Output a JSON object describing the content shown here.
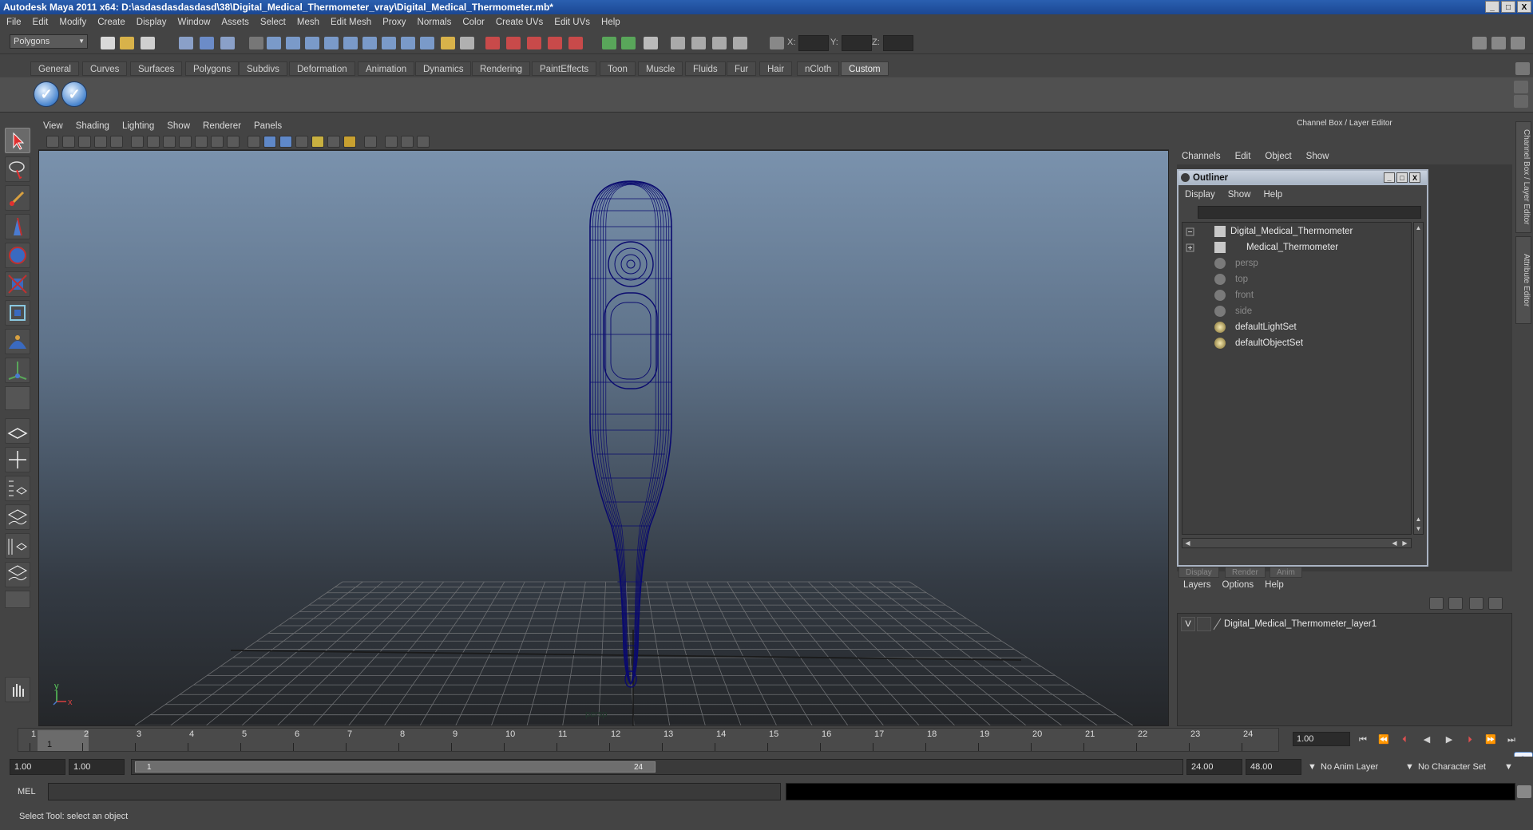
{
  "window": {
    "title": "Autodesk Maya 2011 x64: D:\\asdasdasdasdasd\\38\\Digital_Medical_Thermometer_vray\\Digital_Medical_Thermometer.mb*",
    "buttons": [
      "_",
      "□",
      "X"
    ]
  },
  "menubar": [
    "File",
    "Edit",
    "Modify",
    "Create",
    "Display",
    "Window",
    "Assets",
    "Select",
    "Mesh",
    "Edit Mesh",
    "Proxy",
    "Normals",
    "Color",
    "Create UVs",
    "Edit UVs",
    "Help"
  ],
  "statusline": {
    "mode": "Polygons",
    "coord_labels": [
      "X:",
      "Y:",
      "Z:"
    ]
  },
  "shelf": {
    "tabs": [
      "General",
      "Curves",
      "Surfaces",
      "Polygons",
      "Subdivs",
      "Deformation",
      "Animation",
      "Dynamics",
      "Rendering",
      "PaintEffects",
      "Toon",
      "Muscle",
      "Fluids",
      "Fur",
      "Hair",
      "nCloth",
      "Custom"
    ],
    "active_tab": "Custom",
    "buttons": [
      "check-icon",
      "check-icon"
    ]
  },
  "viewport": {
    "menu": [
      "View",
      "Shading",
      "Lighting",
      "Show",
      "Renderer",
      "Panels"
    ],
    "camera": "persp",
    "axis_y": "y",
    "axis_x": "x"
  },
  "channel_box": {
    "title": "Channel Box / Layer Editor",
    "menu": [
      "Channels",
      "Edit",
      "Object",
      "Show"
    ]
  },
  "side_tabs": [
    "Channel Box / Layer Editor",
    "Attribute Editor"
  ],
  "outliner": {
    "title": "Outliner",
    "menu": [
      "Display",
      "Show",
      "Help"
    ],
    "items": [
      {
        "label": "Digital_Medical_Thermometer",
        "dim": false
      },
      {
        "label": "Medical_Thermometer",
        "dim": false
      },
      {
        "label": "persp",
        "dim": true
      },
      {
        "label": "top",
        "dim": true
      },
      {
        "label": "front",
        "dim": true
      },
      {
        "label": "side",
        "dim": true
      },
      {
        "label": "defaultLightSet",
        "dim": false
      },
      {
        "label": "defaultObjectSet",
        "dim": false
      }
    ]
  },
  "layer_editor": {
    "tabs": [
      "Display",
      "Render",
      "Anim"
    ],
    "menu": [
      "Layers",
      "Options",
      "Help"
    ],
    "layer": {
      "visible": "V",
      "name": "Digital_Medical_Thermometer_layer1"
    }
  },
  "time_slider": {
    "ticks": [
      "1",
      "2",
      "3",
      "4",
      "5",
      "6",
      "7",
      "8",
      "9",
      "10",
      "11",
      "12",
      "13",
      "14",
      "15",
      "16",
      "17",
      "18",
      "19",
      "20",
      "21",
      "22",
      "23",
      "24"
    ],
    "current_marker": "1",
    "current_frame": "1.00"
  },
  "range_slider": {
    "start": "1.00",
    "anim_start": "1.00",
    "range_start": "1",
    "range_end": "24",
    "anim_end": "24.00",
    "end": "48.00",
    "anim_layer": "No Anim Layer",
    "character_set": "No Character Set"
  },
  "command_line": {
    "label": "MEL"
  },
  "help_line": "Select Tool: select an object",
  "colors": {
    "wireframe": "#0a0a6e",
    "viewport_top": "#7a92ad",
    "viewport_bottom": "#242629",
    "title_bar": "#1f4c9c"
  }
}
